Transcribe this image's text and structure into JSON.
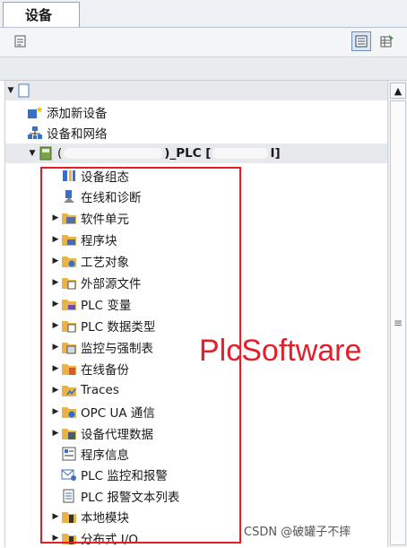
{
  "tab": {
    "label": "设备"
  },
  "project": {
    "name_redacted": true
  },
  "device_row": {
    "prefix": "(",
    "middle": ")_PLC [",
    "suffix": "I]"
  },
  "tree": {
    "add_device": "添加新设备",
    "devices_networks": "设备和网络",
    "items": [
      {
        "label": "设备组态"
      },
      {
        "label": "在线和诊断"
      },
      {
        "label": "软件单元"
      },
      {
        "label": "程序块"
      },
      {
        "label": "工艺对象"
      },
      {
        "label": "外部源文件"
      },
      {
        "label": "PLC 变量"
      },
      {
        "label": "PLC 数据类型"
      },
      {
        "label": "监控与强制表"
      },
      {
        "label": "在线备份"
      },
      {
        "label": "Traces"
      },
      {
        "label": "OPC UA 通信"
      },
      {
        "label": "设备代理数据"
      },
      {
        "label": "程序信息"
      },
      {
        "label": "PLC 监控和报警"
      },
      {
        "label": "PLC 报警文本列表"
      },
      {
        "label": "本地模块"
      },
      {
        "label": "分布式 I/O"
      }
    ]
  },
  "annotation": "PlcSoftware",
  "watermark": "CSDN @破罐子不摔",
  "colors": {
    "highlight": "#e41e2b",
    "folder": "#e8b34a",
    "selection": "#e7e9ec"
  }
}
